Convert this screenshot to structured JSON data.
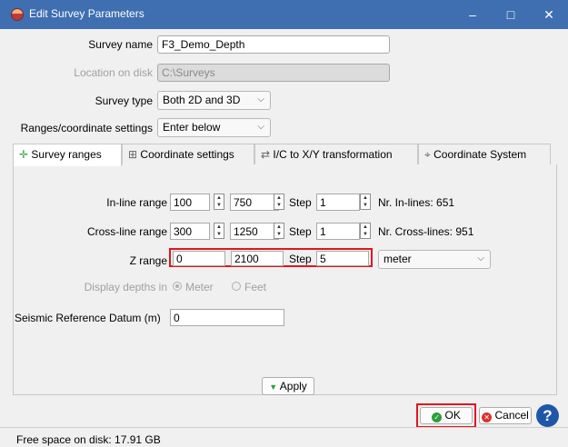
{
  "window": {
    "title": "Edit Survey Parameters",
    "minimize": "–",
    "maximize": "□",
    "close": "✕",
    "icon": "survey-app-icon"
  },
  "form": {
    "survey_name_label": "Survey name",
    "survey_name_value": "F3_Demo_Depth",
    "location_label": "Location on disk",
    "location_value": "C:\\Surveys",
    "survey_type_label": "Survey type",
    "survey_type_value": "Both 2D and 3D",
    "ranges_label": "Ranges/coordinate settings",
    "ranges_value": "Enter below"
  },
  "tabs": [
    {
      "label": "Survey ranges",
      "icon": "crosshair-icon"
    },
    {
      "label": "Coordinate settings",
      "icon": "grid-icon"
    },
    {
      "label": "I/C to X/Y transformation",
      "icon": "transform-icon"
    },
    {
      "label": "Coordinate System",
      "icon": "globe-pin-icon"
    }
  ],
  "ranges": {
    "inline": {
      "label": "In-line range",
      "start": "100",
      "stop": "750",
      "step_label": "Step",
      "step": "1",
      "count_text": "Nr. In-lines: 651"
    },
    "crossline": {
      "label": "Cross-line range",
      "start": "300",
      "stop": "1250",
      "step_label": "Step",
      "step": "1",
      "count_text": "Nr. Cross-lines: 951"
    },
    "z": {
      "label": "Z range",
      "start": "0",
      "stop": "2100",
      "step_label": "Step",
      "step": "5",
      "unit": "meter"
    },
    "display_depths_label": "Display depths in",
    "display_options": [
      "Meter",
      "Feet"
    ],
    "display_selected": "Meter",
    "srd_label": "Seismic Reference Datum (m)",
    "srd_value": "0"
  },
  "buttons": {
    "apply": "Apply",
    "ok": "OK",
    "cancel": "Cancel",
    "help": "?"
  },
  "status": {
    "free_space": "Free space on disk: 17.91 GB"
  },
  "colors": {
    "titlebar": "#3f6fb1",
    "highlight": "#e0161f",
    "ok_icon": "#2e9e3a",
    "cancel_icon": "#d9342b",
    "help": "#1f57a8"
  }
}
